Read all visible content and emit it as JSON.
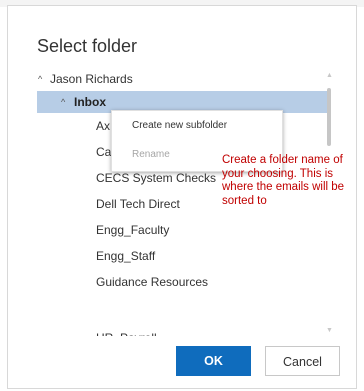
{
  "dialog": {
    "title": "Select folder",
    "ok_label": "OK",
    "cancel_label": "Cancel"
  },
  "tree": {
    "root": {
      "caret": "^",
      "label": "Jason Richards"
    },
    "selected": {
      "caret": "^",
      "label": "Inbox"
    },
    "children": [
      {
        "label": "Ax"
      },
      {
        "label": "Ca"
      },
      {
        "label": "CECS System Checks"
      },
      {
        "label": "Dell Tech Direct"
      },
      {
        "label": "Engg_Faculty"
      },
      {
        "label": "Engg_Staff"
      },
      {
        "label": "Guidance Resources"
      },
      {
        "label": "HR_Payroll"
      }
    ]
  },
  "context_menu": {
    "create_label": "Create new subfolder",
    "rename_label": "Rename"
  },
  "annotation": {
    "text": "Create a folder name of your choosing. This is where the emails will be sorted to"
  },
  "icons": {
    "expanded": "chevron-up-icon",
    "scroll_up": "scroll-up-arrow-icon",
    "scroll_down": "scroll-down-arrow-icon"
  },
  "colors": {
    "selected_row": "#b7cde6",
    "primary_button": "#0f6cbd",
    "annotation": "#c00000"
  }
}
